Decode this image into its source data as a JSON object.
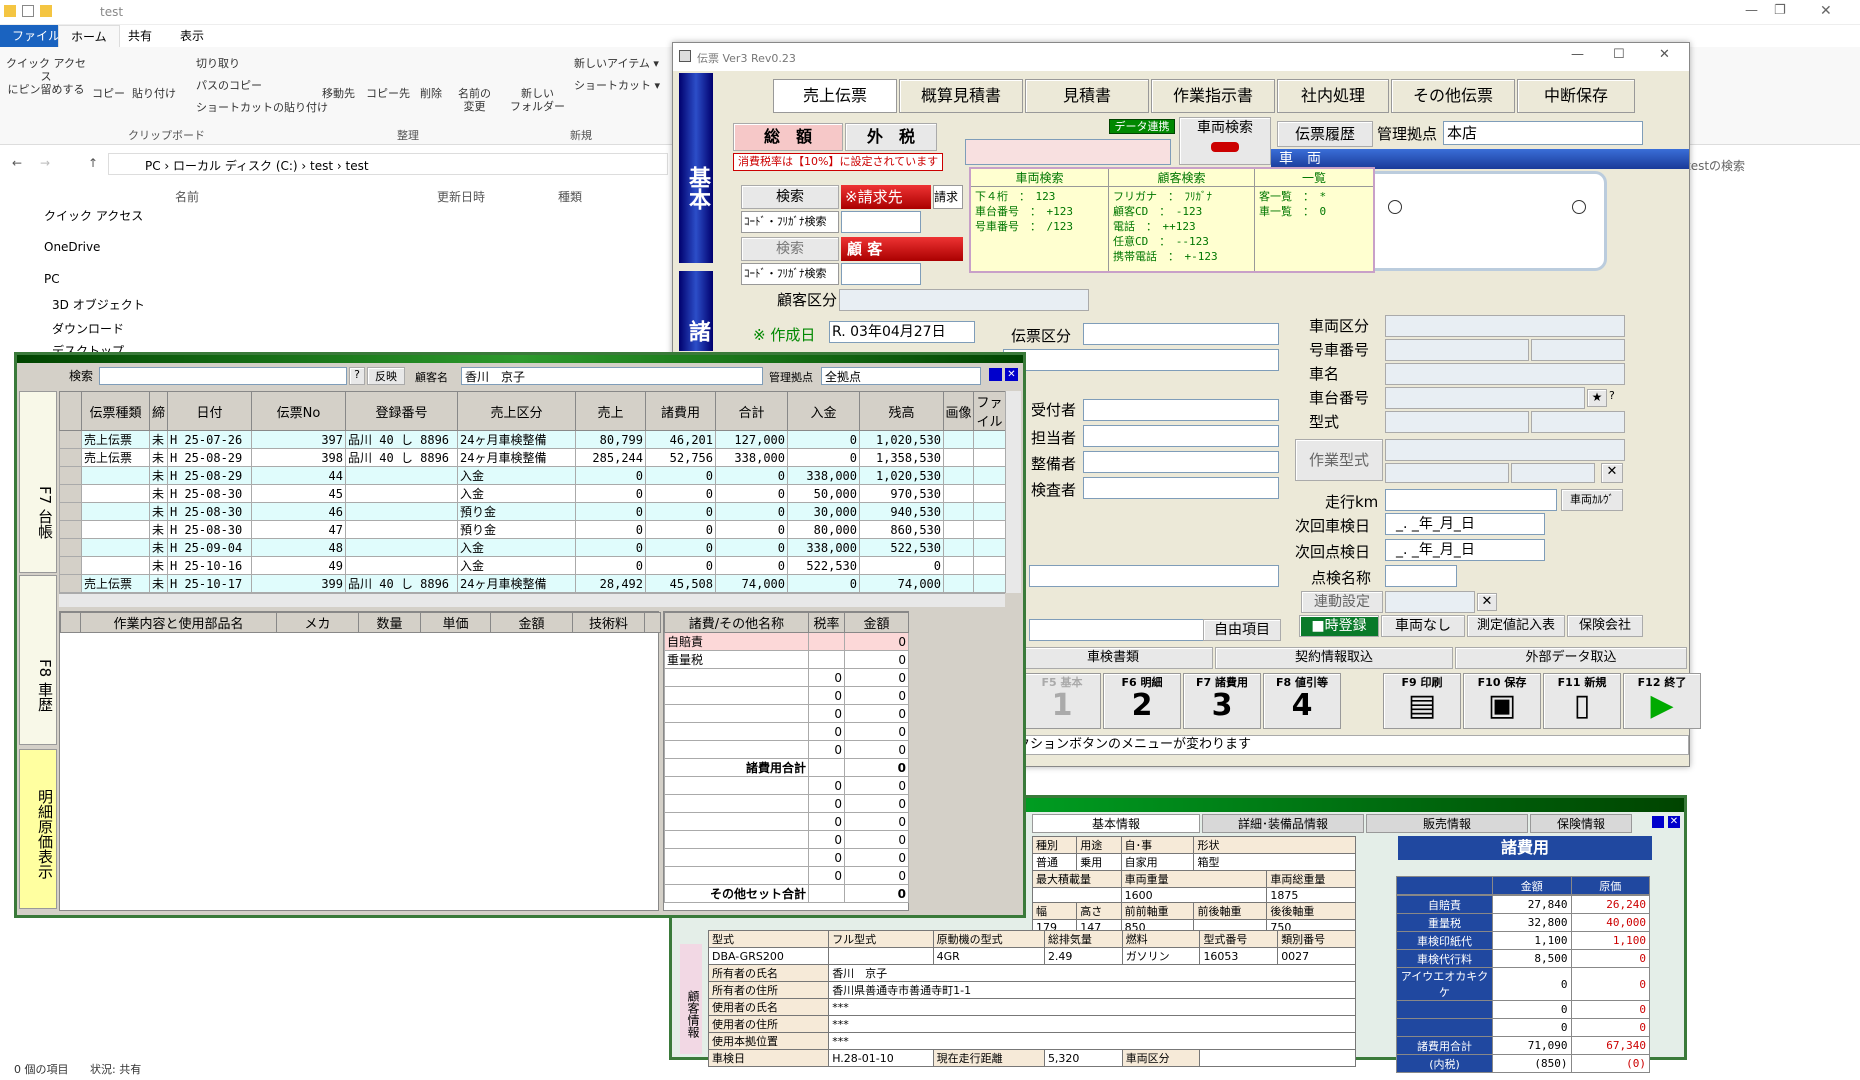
{
  "explorer": {
    "title": "test",
    "tabs": [
      "ファイル",
      "ホーム",
      "共有",
      "表示"
    ],
    "ribbon": {
      "pin": "クイック アクセス\nにピン留めする",
      "copy": "コピー",
      "paste": "貼り付け",
      "cut": "切り取り",
      "copy_path": "パスのコピー",
      "paste_shortcut": "ショートカットの貼り付け",
      "group_clipboard": "クリップボード",
      "move": "移動先",
      "copyto": "コピー先",
      "delete": "削除",
      "rename": "名前の\n変更",
      "group_org": "整理",
      "newfolder": "新しい\nフォルダー",
      "new_item": "新しいアイテム ▾",
      "shortcut": "ショートカット ▾",
      "group_new": "新規"
    },
    "address": "PC › ローカル ディスク (C:) › test › test",
    "search": "testの検索",
    "nav": [
      "クイック アクセス",
      "OneDrive",
      "PC",
      "3D オブジェクト",
      "ダウンロード",
      "デスクトップ"
    ],
    "columns": [
      "名前",
      "更新日時",
      "種類"
    ],
    "status": "0 個の項目",
    "status2": "状況: 共有"
  },
  "denpyo": {
    "title": "伝票 Ver3 Rev0.23",
    "tabs": [
      "売上伝票",
      "概算見積書",
      "見積書",
      "作業指示書",
      "社内処理",
      "その他伝票",
      "中断保存"
    ],
    "side_top": "基本",
    "side_bottom": "諸",
    "total": "総　額",
    "tax": "外　税",
    "tax_note": "消費税率は【10%】に設定されています",
    "data_link": "データ連携",
    "vehicle_search": "車両検索",
    "history": "伝票履歴",
    "base_label": "管理拠点",
    "base_value": "本店",
    "search": "検索",
    "billing": "※請求先",
    "billing2": "請求",
    "code_kana": "ｺｰﾄﾞ・ﾌﾘｶﾞﾅ検索",
    "search2": "検索",
    "customer": "顧 客",
    "customer_kind": "顧客区分",
    "created_label": "※ 作成日",
    "created": "R. 03年04月27日",
    "slip_kind": "伝票区分",
    "recv": "受付者",
    "owner": "担当者",
    "mech": "整備者",
    "inspect": "検査者",
    "vehicle_header": "車　両",
    "v_labels": [
      "車両区分",
      "号車番号",
      "車名",
      "車台番号",
      "型式"
    ],
    "work_type": "作業型式",
    "mileage": "走行km",
    "mileage_btn": "車両ｶﾙｳﾞ",
    "next_shaken": "次回車検日",
    "next_tenken": "次回点検日",
    "date_ph": "_. _年_月_日",
    "tenken_name": "点検名称",
    "linked": "連動設定",
    "free": "自由項目",
    "btns": [
      "■時登録",
      "車両なし",
      "測定値記入表",
      "保険会社"
    ],
    "row2": [
      "車検書類",
      "契約情報取込",
      "外部データ取込"
    ],
    "fkeys": [
      {
        "k": "F5 基本",
        "n": "1"
      },
      {
        "k": "F6 明細",
        "n": "2"
      },
      {
        "k": "F7 諸費用",
        "n": "3"
      },
      {
        "k": "F8 値引等",
        "n": "4"
      },
      {
        "k": "F9 印刷",
        "n": ""
      },
      {
        "k": "F10 保存",
        "n": ""
      },
      {
        "k": "F11 新規",
        "n": ""
      },
      {
        "k": "F12 終了",
        "n": ""
      }
    ],
    "status": "クションボタンのメニューが変わります",
    "popup": {
      "h1": "車両検索",
      "h2": "顧客検索",
      "h3": "一覧",
      "c1": [
        "下４桁　：　123",
        "車台番号　：　+123",
        "号車番号　：　/123"
      ],
      "c2": [
        "フリガナ　：　ﾌﾘｶﾞﾅ",
        "顧客CD　：　-123",
        "電話　：　++123",
        "任意CD　：　--123",
        "携帯電話　：　+-123"
      ],
      "c3": [
        "客一覧　：　*",
        "車一覧　：　0"
      ]
    }
  },
  "ledger": {
    "search": "検索",
    "reflect": "反映",
    "cust_label": "顧客名",
    "cust": "香川　京子",
    "base_label": "管理拠点",
    "base": "全拠点",
    "side": [
      "F7 台帳",
      "F8 車歴",
      "明細原価表示"
    ],
    "headers": [
      "伝票種類",
      "締",
      "日付",
      "伝票No",
      "登録番号",
      "売上区分",
      "売上",
      "諸費用",
      "合計",
      "入金",
      "残高",
      "画像",
      "ファイル"
    ],
    "rows": [
      [
        "売上伝票",
        "未",
        "H 25-07-26",
        "397",
        "品川 40 し 8896",
        "24ヶ月車検整備",
        "80,799",
        "46,201",
        "127,000",
        "0",
        "1,020,530",
        "",
        ""
      ],
      [
        "売上伝票",
        "未",
        "H 25-08-29",
        "398",
        "品川 40 し 8896",
        "24ヶ月車検整備",
        "285,244",
        "52,756",
        "338,000",
        "0",
        "1,358,530",
        "",
        ""
      ],
      [
        "",
        "未",
        "H 25-08-29",
        "44",
        "",
        "入金",
        "0",
        "0",
        "0",
        "338,000",
        "1,020,530",
        "",
        ""
      ],
      [
        "",
        "未",
        "H 25-08-30",
        "45",
        "",
        "入金",
        "0",
        "0",
        "0",
        "50,000",
        "970,530",
        "",
        ""
      ],
      [
        "",
        "未",
        "H 25-08-30",
        "46",
        "",
        "預り金",
        "0",
        "0",
        "0",
        "30,000",
        "940,530",
        "",
        ""
      ],
      [
        "",
        "未",
        "H 25-08-30",
        "47",
        "",
        "預り金",
        "0",
        "0",
        "0",
        "80,000",
        "860,530",
        "",
        ""
      ],
      [
        "",
        "未",
        "H 25-09-04",
        "48",
        "",
        "入金",
        "0",
        "0",
        "0",
        "338,000",
        "522,530",
        "",
        ""
      ],
      [
        "",
        "未",
        "H 25-10-16",
        "49",
        "",
        "入金",
        "0",
        "0",
        "0",
        "522,530",
        "0",
        "",
        ""
      ],
      [
        "売上伝票",
        "未",
        "H 25-10-17",
        "399",
        "品川 40 し 8896",
        "24ヶ月車検整備",
        "28,492",
        "45,508",
        "74,000",
        "0",
        "74,000",
        "",
        ""
      ],
      [
        "",
        "未",
        "H 25-10-17",
        "50",
        "",
        "入金",
        "0",
        "0",
        "0",
        "74,000",
        "0",
        "",
        ""
      ]
    ],
    "detail_headers": [
      "作業内容と使用部品名",
      "メカ",
      "数量",
      "単価",
      "金額",
      "技術料"
    ],
    "cost_headers": [
      "諸費/その他名称",
      "税率",
      "金額"
    ],
    "cost_rows": [
      [
        "自賠責",
        "",
        "0"
      ],
      [
        "重量税",
        "",
        "0"
      ],
      [
        "",
        "0",
        "0"
      ],
      [
        "",
        "0",
        "0"
      ],
      [
        "",
        "0",
        "0"
      ],
      [
        "",
        "0",
        "0"
      ],
      [
        "",
        "0",
        "0"
      ],
      [
        "諸費用合計",
        "",
        "0"
      ],
      [
        "",
        "0",
        "0"
      ],
      [
        "",
        "0",
        "0"
      ],
      [
        "",
        "0",
        "0"
      ],
      [
        "",
        "0",
        "0"
      ],
      [
        "",
        "0",
        "0"
      ],
      [
        "",
        "0",
        "0"
      ],
      [
        "その他セット合計",
        "",
        "0"
      ]
    ]
  },
  "vehicle": {
    "tabs": [
      "基本情報",
      "詳細･装備品情報",
      "販売情報",
      "保険情報"
    ],
    "r1h": [
      "種別",
      "用途",
      "自･事",
      "形状"
    ],
    "r1": [
      "普通",
      "乗用",
      "自家用",
      "箱型"
    ],
    "r2h": [
      "最大積載量",
      "車両重量",
      "車両総重量"
    ],
    "r2": [
      "",
      "1600",
      "1875"
    ],
    "r3h": [
      "幅",
      "高さ",
      "前前軸重",
      "前後軸重",
      "後前軸重",
      "後後軸重"
    ],
    "r3": [
      "179",
      "147",
      "850",
      "",
      "",
      "750"
    ],
    "r4h": [
      "型式",
      "フル型式",
      "原動機の型式",
      "総排気量",
      "燃料",
      "型式番号",
      "類別番号"
    ],
    "r4": [
      "DBA-GRS200",
      "",
      "4GR",
      "2.49",
      "ガソリン",
      "16053",
      "0027"
    ],
    "owner": [
      [
        "所有者の氏名",
        "香川　京子"
      ],
      [
        "所有者の住所",
        "香川県善通寺市善通寺町1-1"
      ],
      [
        "使用者の氏名",
        "***"
      ],
      [
        "使用者の住所",
        "***"
      ],
      [
        "使用本拠位置",
        "***"
      ]
    ],
    "shaken_label": "車検日",
    "shaken": "H.28-01-10",
    "dist_label": "現在走行距離",
    "dist": "5,320",
    "kubun_label": "車両区分",
    "side": "顧客情報",
    "shohiyo_title": "諸費用",
    "sh_cols": [
      "金額",
      "原価"
    ],
    "sh_rows": [
      [
        "自賠責",
        "27,840",
        "26,240"
      ],
      [
        "重量税",
        "32,800",
        "40,000"
      ],
      [
        "車検印紙代",
        "1,100",
        "1,100"
      ],
      [
        "車検代行料",
        "8,500",
        "0"
      ],
      [
        "アイウエオカキクケ",
        "0",
        "0"
      ],
      [
        "",
        "0",
        "0"
      ],
      [
        "",
        "0",
        "0"
      ],
      [
        "諸費用合計",
        "71,090",
        "67,340"
      ],
      [
        "(内税)",
        "(850)",
        "(0)"
      ]
    ]
  }
}
